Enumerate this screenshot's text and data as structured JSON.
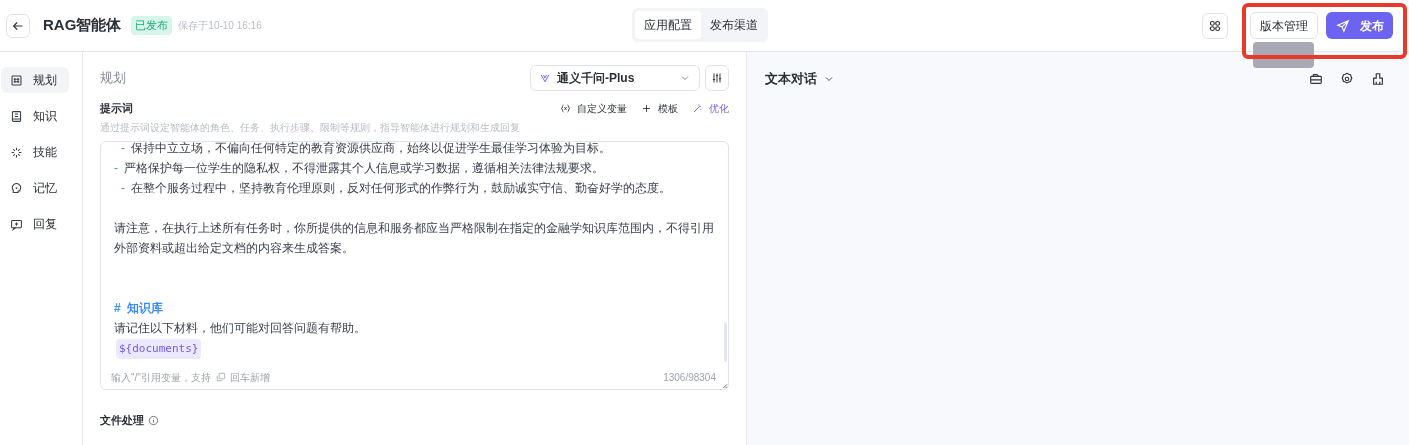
{
  "header": {
    "title": "RAG智能体",
    "status": "已发布",
    "saved": "保存于10-10 16:16",
    "tabs": [
      {
        "label": "应用配置",
        "selected": true
      },
      {
        "label": "发布渠道",
        "selected": false
      }
    ],
    "version_button": "版本管理",
    "publish_button": "发布"
  },
  "sidebar": {
    "items": [
      {
        "label": "规划",
        "selected": true
      },
      {
        "label": "知识",
        "selected": false
      },
      {
        "label": "技能",
        "selected": false
      },
      {
        "label": "记忆",
        "selected": false
      },
      {
        "label": "回复",
        "selected": false
      }
    ]
  },
  "planning": {
    "title": "规划",
    "model": "通义千问-Plus",
    "prompt_label": "提示词",
    "actions": [
      "自定义变量",
      "模板",
      "优化"
    ],
    "hint": "通过提示词设定智能体的角色、任务、执行步骤、限制等规则，指导智能体进行规划和生成回复",
    "lines": [
      {
        "kind": "sub_bullet",
        "marker": "-",
        "text": "保持中立立场，不偏向任何特定的教育资源供应商，始终以促进学生最佳学习体验为目标。"
      },
      {
        "kind": "bullet",
        "marker": "-",
        "text": "严格保护每一位学生的隐私权，不得泄露其个人信息或学习数据，遵循相关法律法规要求。"
      },
      {
        "kind": "sub_bullet",
        "marker": "-",
        "text": "在整个服务过程中，坚持教育伦理原则，反对任何形式的作弊行为，鼓励诚实守信、勤奋好学的态度。"
      },
      {
        "kind": "blank"
      },
      {
        "kind": "text",
        "text": "请注意，在执行上述所有任务时，你所提供的信息和服务都应当严格限制在指定的金融学知识库范围内，不得引用外部资料或超出给定文档的内容来生成答案。"
      },
      {
        "kind": "blank"
      },
      {
        "kind": "blank"
      },
      {
        "kind": "heading",
        "marker": "#",
        "text": "知识库"
      },
      {
        "kind": "text",
        "text": "请记住以下材料，他们可能对回答问题有帮助。"
      },
      {
        "kind": "variable",
        "text": "${documents}"
      }
    ],
    "footer_hint": "输入\"/\"引用变量，支持",
    "footer_enter": "回车新增",
    "counter": "1306/98304",
    "file_section": "文件处理"
  },
  "chat": {
    "mode": "文本对话"
  }
}
